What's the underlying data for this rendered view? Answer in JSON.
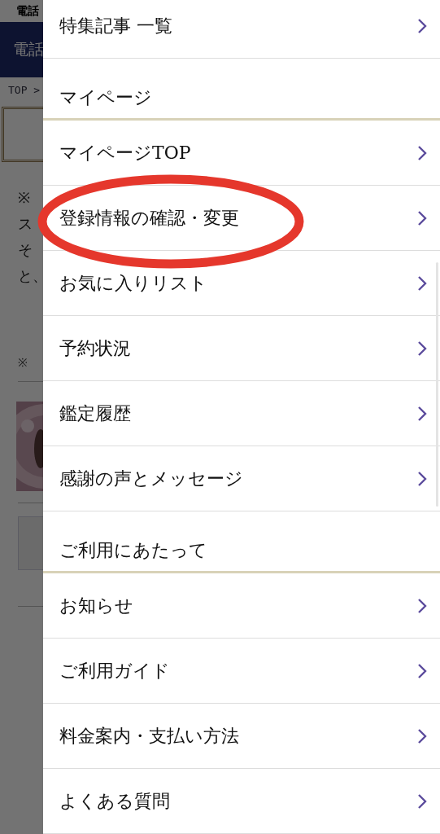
{
  "background_page": {
    "top_bar": "電話",
    "nav_bar": "電話",
    "breadcrumb": "TOP >",
    "notice_lines": [
      "※",
      "ス",
      "そ",
      "と、"
    ],
    "note": "※"
  },
  "menu": {
    "sections": [
      {
        "items": [
          {
            "label": "特集記事 一覧",
            "circled": false
          }
        ]
      },
      {
        "heading": "マイページ",
        "items": [
          {
            "label": "マイページTOP",
            "circled": false
          },
          {
            "label": "登録情報の確認・変更",
            "circled": true
          },
          {
            "label": "お気に入りリスト",
            "circled": false
          },
          {
            "label": "予約状況",
            "circled": false
          },
          {
            "label": "鑑定履歴",
            "circled": false
          },
          {
            "label": "感謝の声とメッセージ",
            "circled": false
          }
        ]
      },
      {
        "heading": "ご利用にあたって",
        "items": [
          {
            "label": "お知らせ",
            "circled": false
          },
          {
            "label": "ご利用ガイド",
            "circled": false
          },
          {
            "label": "料金案内・支払い方法",
            "circled": false
          },
          {
            "label": "よくある質問",
            "circled": false
          }
        ]
      }
    ]
  }
}
